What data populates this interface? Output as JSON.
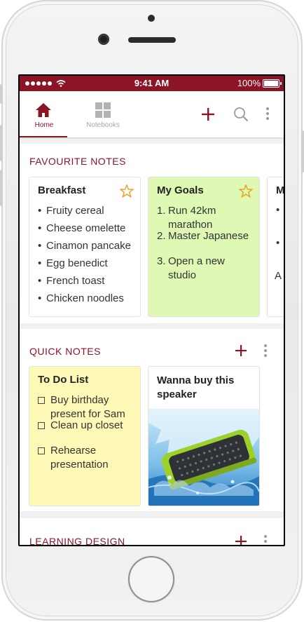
{
  "status_bar": {
    "time": "9:41 AM",
    "battery": "100%"
  },
  "nav": {
    "tabs": [
      {
        "label": "Home",
        "active": true
      },
      {
        "label": "Notebooks",
        "active": false
      }
    ],
    "actions": [
      "add-icon",
      "search-icon",
      "more-icon"
    ]
  },
  "colors": {
    "brand": "#8c1427",
    "green_card": "#dff8b4",
    "yellow_card": "#fff9b7"
  },
  "favourite": {
    "title": "FAVOURITE NOTES",
    "cards": [
      {
        "title": "Breakfast",
        "starred": true,
        "items": [
          "Fruity cereal",
          "Cheese omelette",
          "Cinamon pancake",
          "Egg benedict",
          "French toast",
          "Chicken noodles"
        ]
      },
      {
        "title": "My Goals",
        "starred": true,
        "items": [
          "Run 42km marathon",
          "Master Japanese",
          "Open a new studio"
        ]
      },
      {
        "title": "M",
        "partial_text": "A"
      }
    ]
  },
  "quick": {
    "title": "QUICK NOTES",
    "cards": [
      {
        "title": "To Do List",
        "items": [
          "Buy birthday present for Sam",
          "Clean up closet",
          "Rehearse presentation"
        ]
      },
      {
        "title": "Wanna buy this speaker",
        "image": "green speaker splashing in water"
      }
    ]
  },
  "learning": {
    "title": "LEARNING DESIGN"
  }
}
